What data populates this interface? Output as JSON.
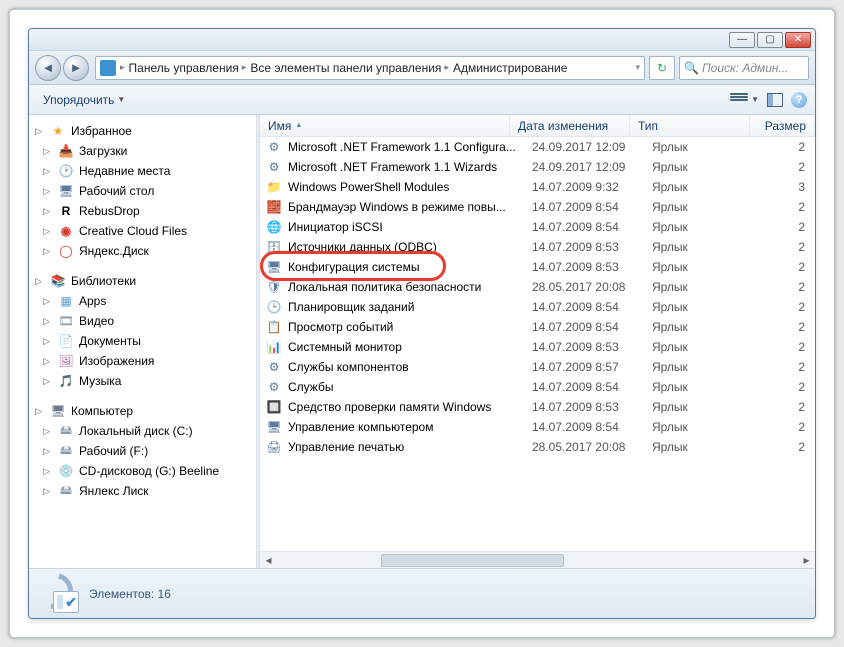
{
  "window": {
    "minimize": "—",
    "maximize": "▢",
    "close": "✕"
  },
  "addressbar": {
    "segments": [
      "Панель управления",
      "Все элементы панели управления",
      "Администрирование"
    ],
    "refresh": "↻"
  },
  "search": {
    "placeholder": "Поиск: Админ..."
  },
  "toolbar": {
    "organize": "Упорядочить",
    "help": "?"
  },
  "sidebar": {
    "favorites": {
      "label": "Избранное",
      "items": [
        {
          "icon": "📥",
          "label": "Загрузки",
          "ic": "ic-folder"
        },
        {
          "icon": "🕑",
          "label": "Недавние места",
          "ic": "ic-recent"
        },
        {
          "icon": "🖥",
          "label": "Рабочий стол",
          "ic": "ic-desktop"
        },
        {
          "icon": "R",
          "label": "RebusDrop",
          "ic": "ic-r"
        },
        {
          "icon": "◉",
          "label": "Creative Cloud Files",
          "ic": "ic-cc"
        },
        {
          "icon": "◯",
          "label": "Яндекс.Диск",
          "ic": "ic-yd"
        }
      ]
    },
    "libraries": {
      "label": "Библиотеки",
      "items": [
        {
          "icon": "▦",
          "label": "Apps",
          "ic": "ic-app"
        },
        {
          "icon": "🎞",
          "label": "Видео",
          "ic": "ic-vid"
        },
        {
          "icon": "📄",
          "label": "Документы",
          "ic": "ic-doc"
        },
        {
          "icon": "🖼",
          "label": "Изображения",
          "ic": "ic-img"
        },
        {
          "icon": "🎵",
          "label": "Музыка",
          "ic": "ic-mus"
        }
      ]
    },
    "computer": {
      "label": "Компьютер",
      "items": [
        {
          "icon": "🖴",
          "label": "Локальный диск (C:)",
          "ic": "ic-disk"
        },
        {
          "icon": "🖴",
          "label": "Рабочий (F:)",
          "ic": "ic-disk"
        },
        {
          "icon": "💿",
          "label": "CD-дисковод (G:) Beeline",
          "ic": "ic-cd"
        },
        {
          "icon": "🖴",
          "label": "Янлекс Лиск",
          "ic": "ic-disk"
        }
      ]
    }
  },
  "columns": {
    "name": "Имя",
    "date": "Дата изменения",
    "type": "Тип",
    "size": "Размер"
  },
  "files": [
    {
      "icon": "⚙",
      "name": "Microsoft .NET Framework 1.1 Configura...",
      "date": "24.09.2017 12:09",
      "type": "Ярлык",
      "size": "2"
    },
    {
      "icon": "⚙",
      "name": "Microsoft .NET Framework 1.1 Wizards",
      "date": "24.09.2017 12:09",
      "type": "Ярлык",
      "size": "2"
    },
    {
      "icon": "📁",
      "name": "Windows PowerShell Modules",
      "date": "14.07.2009 9:32",
      "type": "Ярлык",
      "size": "3"
    },
    {
      "icon": "🧱",
      "name": "Брандмауэр Windows в режиме повы...",
      "date": "14.07.2009 8:54",
      "type": "Ярлык",
      "size": "2"
    },
    {
      "icon": "🌐",
      "name": "Инициатор iSCSI",
      "date": "14.07.2009 8:54",
      "type": "Ярлык",
      "size": "2"
    },
    {
      "icon": "🗄",
      "name": "Источники данных (ODBC)",
      "date": "14.07.2009 8:53",
      "type": "Ярлык",
      "size": "2"
    },
    {
      "icon": "🖥",
      "name": "Конфигурация системы",
      "date": "14.07.2009 8:53",
      "type": "Ярлык",
      "size": "2",
      "highlight": true
    },
    {
      "icon": "🛡",
      "name": "Локальная политика безопасности",
      "date": "28.05.2017 20:08",
      "type": "Ярлык",
      "size": "2"
    },
    {
      "icon": "🕒",
      "name": "Планировщик заданий",
      "date": "14.07.2009 8:54",
      "type": "Ярлык",
      "size": "2"
    },
    {
      "icon": "📋",
      "name": "Просмотр событий",
      "date": "14.07.2009 8:54",
      "type": "Ярлык",
      "size": "2"
    },
    {
      "icon": "📊",
      "name": "Системный монитор",
      "date": "14.07.2009 8:53",
      "type": "Ярлык",
      "size": "2"
    },
    {
      "icon": "⚙",
      "name": "Службы компонентов",
      "date": "14.07.2009 8:57",
      "type": "Ярлык",
      "size": "2"
    },
    {
      "icon": "⚙",
      "name": "Службы",
      "date": "14.07.2009 8:54",
      "type": "Ярлык",
      "size": "2"
    },
    {
      "icon": "🔲",
      "name": "Средство проверки памяти Windows",
      "date": "14.07.2009 8:53",
      "type": "Ярлык",
      "size": "2"
    },
    {
      "icon": "🖥",
      "name": "Управление компьютером",
      "date": "14.07.2009 8:54",
      "type": "Ярлык",
      "size": "2"
    },
    {
      "icon": "🖨",
      "name": "Управление печатью",
      "date": "28.05.2017 20:08",
      "type": "Ярлык",
      "size": "2"
    }
  ],
  "status": {
    "text": "Элементов: 16"
  }
}
